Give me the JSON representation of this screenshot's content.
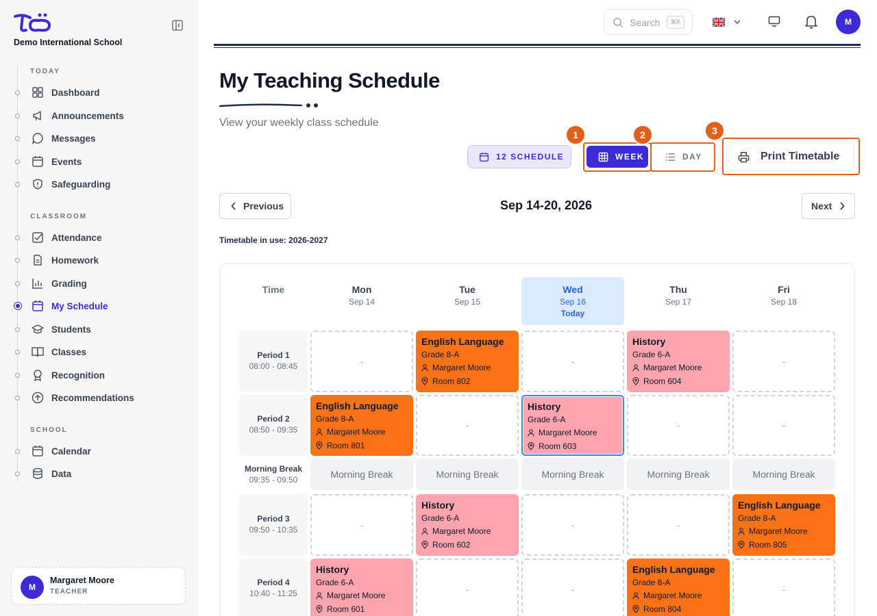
{
  "sidebar": {
    "school_name": "Demo International School",
    "sections": [
      {
        "title": "TODAY",
        "items": [
          {
            "label": "Dashboard",
            "icon": "dashboard-icon"
          },
          {
            "label": "Announcements",
            "icon": "megaphone-icon"
          },
          {
            "label": "Messages",
            "icon": "message-icon"
          },
          {
            "label": "Events",
            "icon": "calendar-icon"
          },
          {
            "label": "Safeguarding",
            "icon": "shield-icon"
          }
        ]
      },
      {
        "title": "CLASSROOM",
        "items": [
          {
            "label": "Attendance",
            "icon": "checkbox-icon"
          },
          {
            "label": "Homework",
            "icon": "document-icon"
          },
          {
            "label": "Grading",
            "icon": "bar-chart-icon"
          },
          {
            "label": "My Schedule",
            "icon": "calendar-icon",
            "active": true
          },
          {
            "label": "Students",
            "icon": "graduation-cap-icon"
          },
          {
            "label": "Classes",
            "icon": "book-icon"
          },
          {
            "label": "Recognition",
            "icon": "award-icon"
          },
          {
            "label": "Recommendations",
            "icon": "arrow-up-circle-icon"
          }
        ]
      },
      {
        "title": "SCHOOL",
        "items": [
          {
            "label": "Calendar",
            "icon": "calendar-icon"
          },
          {
            "label": "Data",
            "icon": "database-icon"
          }
        ]
      }
    ],
    "user": {
      "initial": "M",
      "name": "Margaret Moore",
      "role": "TEACHER"
    }
  },
  "topbar": {
    "search_placeholder": "Search",
    "search_shortcut": "⌘K",
    "avatar_initial": "M"
  },
  "header": {
    "title": "My Teaching Schedule",
    "subtitle": "View your weekly class schedule"
  },
  "controls": {
    "schedule_count": "12 SCHEDULE",
    "week_label": "WEEK",
    "day_label": "DAY",
    "print_label": "Print Timetable",
    "callouts": [
      "1",
      "2",
      "3"
    ],
    "prev_label": "Previous",
    "next_label": "Next",
    "week_range": "Sep 14-20, 2026",
    "timetable_note": "Timetable in use: 2026-2027"
  },
  "grid": {
    "time_header": "Time",
    "today_label": "Today",
    "days": [
      {
        "day": "Mon",
        "date": "Sep 14"
      },
      {
        "day": "Tue",
        "date": "Sep 15"
      },
      {
        "day": "Wed",
        "date": "Sep 16",
        "today": true
      },
      {
        "day": "Thu",
        "date": "Sep 17"
      },
      {
        "day": "Fri",
        "date": "Sep 18"
      }
    ],
    "periods": [
      {
        "name": "Period 1",
        "time": "08:00 - 08:45"
      },
      {
        "name": "Period 2",
        "time": "08:50 - 09:35"
      },
      {
        "name": "Morning Break",
        "time": "09:35 - 09:50"
      },
      {
        "name": "Period 3",
        "time": "09:50 - 10:35"
      },
      {
        "name": "Period 4",
        "time": "10:40 - 11:25"
      }
    ],
    "empty_text": "-",
    "break_text": "Morning Break",
    "lessons": {
      "p1_tue": {
        "subject": "English Language",
        "grade": "Grade 8-A",
        "teacher": "Margaret Moore",
        "room": "Room 802",
        "color": "#f97316"
      },
      "p1_thu": {
        "subject": "History",
        "grade": "Grade 6-A",
        "teacher": "Margaret Moore",
        "room": "Room 604",
        "color": "#fda4af"
      },
      "p2_mon": {
        "subject": "English Language",
        "grade": "Grade 8-A",
        "teacher": "Margaret Moore",
        "room": "Room 801",
        "color": "#f97316"
      },
      "p2_wed": {
        "subject": "History",
        "grade": "Grade 6-A",
        "teacher": "Margaret Moore",
        "room": "Room 603",
        "color": "#fda4af"
      },
      "p3_tue": {
        "subject": "History",
        "grade": "Grade 6-A",
        "teacher": "Margaret Moore",
        "room": "Room 602",
        "color": "#fda4af"
      },
      "p3_fri": {
        "subject": "English Language",
        "grade": "Grade 8-A",
        "teacher": "Margaret Moore",
        "room": "Room 805",
        "color": "#f97316"
      },
      "p4_mon": {
        "subject": "History",
        "grade": "Grade 6-A",
        "teacher": "Margaret Moore",
        "room": "Room 601",
        "color": "#fda4af"
      },
      "p4_thu": {
        "subject": "English Language",
        "grade": "Grade 8-A",
        "teacher": "Margaret Moore",
        "room": "Room 804",
        "color": "#f97316"
      }
    }
  },
  "colors": {
    "accent": "#3b2bd6",
    "callout": "#e0621a",
    "navy": "#1e2a5a"
  }
}
